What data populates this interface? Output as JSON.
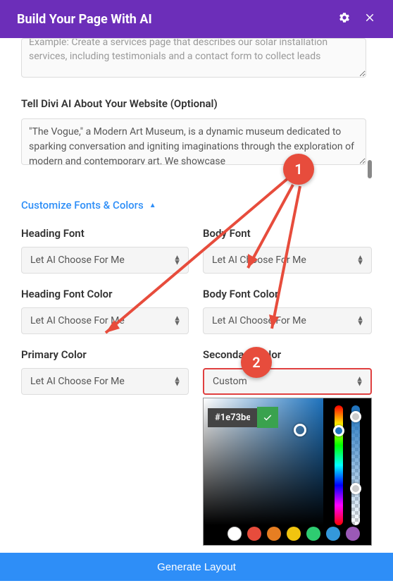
{
  "header": {
    "title": "Build Your Page With AI"
  },
  "prompt_area": {
    "placeholder_text": "Example: Create a services page that describes our solar installation services, including testimonials and a contact form to collect leads"
  },
  "about_section": {
    "label": "Tell Divi AI About Your Website (Optional)",
    "value": "\"The Vogue,\" a Modern Art Museum, is a dynamic museum dedicated to sparking conversation and igniting imaginations through the exploration of modern and contemporary art. We showcase"
  },
  "customize": {
    "link_label": "Customize Fonts & Colors",
    "fields": {
      "heading_font": {
        "label": "Heading Font",
        "value": "Let AI Choose For Me"
      },
      "body_font": {
        "label": "Body Font",
        "value": "Let AI Choose For Me"
      },
      "heading_font_color": {
        "label": "Heading Font Color",
        "value": "Let AI Choose For Me"
      },
      "body_font_color": {
        "label": "Body Font Color",
        "value": "Let AI Choose For Me"
      },
      "primary_color": {
        "label": "Primary Color",
        "value": "Let AI Choose For Me"
      },
      "secondary_color": {
        "label": "Secondary Color",
        "value": "Custom"
      }
    }
  },
  "colorpicker": {
    "hex": "#1e73be",
    "swatches": [
      "#000000",
      "#ffffff",
      "#e74c3c",
      "#e67e22",
      "#f1c40f",
      "#2ecc71",
      "#3498db",
      "#9b59b6"
    ]
  },
  "annotations": {
    "badge1": "1",
    "badge2": "2"
  },
  "footer": {
    "button_label": "Generate Layout"
  }
}
